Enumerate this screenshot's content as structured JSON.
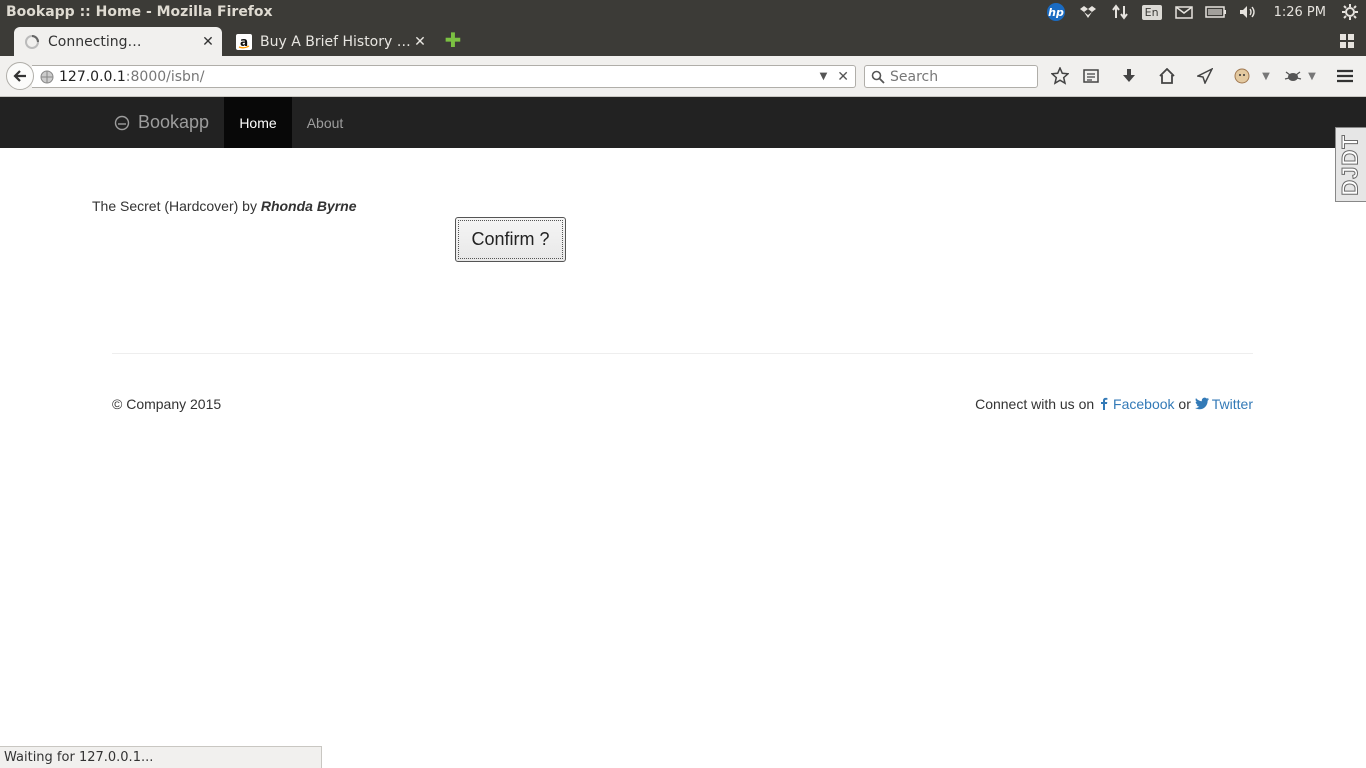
{
  "os": {
    "window_title": "Bookapp :: Home - Mozilla Firefox",
    "tray_lang": "En",
    "time": "1:26 PM"
  },
  "browser": {
    "tabs": [
      {
        "label": "Connecting…",
        "icon": "loading-spinner-icon"
      },
      {
        "label": "Buy A Brief History …",
        "icon": "amazon-icon"
      }
    ],
    "url_host": "127.0.0.1",
    "url_rest": ":8000/isbn/",
    "search_placeholder": "Search",
    "status": "Waiting for 127.0.0.1..."
  },
  "site": {
    "brand": "Bookapp",
    "nav": {
      "home": "Home",
      "about": "About"
    },
    "ddt_label": "DJDT"
  },
  "book": {
    "title_text": "The Secret (Hardcover) by",
    "author": "Rhonda Byrne"
  },
  "confirm_label": "Confirm ?",
  "footer": {
    "copyright": "© Company 2015",
    "connect_text": "Connect with us on",
    "facebook": "Facebook",
    "or": "or",
    "twitter": "Twitter"
  },
  "colors": {
    "navbar_bg": "#222222",
    "link": "#337ab7",
    "os_bar": "#3c3b37"
  }
}
